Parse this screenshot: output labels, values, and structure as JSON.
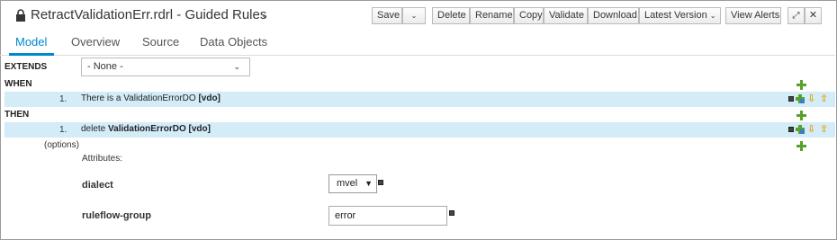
{
  "header": {
    "title": "RetractValidationErr.rdrl - Guided Rules",
    "buttons": {
      "save": "Save",
      "delete": "Delete",
      "rename": "Rename",
      "copy": "Copy",
      "validate": "Validate",
      "download": "Download",
      "latest_version": "Latest Version",
      "view_alerts": "View Alerts"
    }
  },
  "tabs": [
    "Model",
    "Overview",
    "Source",
    "Data Objects"
  ],
  "active_tab": "Model",
  "rule": {
    "extends_label": "EXTENDS",
    "extends_value": "- None -",
    "when_label": "WHEN",
    "when_rows": [
      {
        "num": "1.",
        "text": "There is a ValidationErrorDO",
        "binding": "[vdo]"
      }
    ],
    "then_label": "THEN",
    "then_rows": [
      {
        "num": "1.",
        "prefix": "delete",
        "text": "ValidationErrorDO [vdo]"
      }
    ],
    "options_label": "(options)",
    "attributes_label": "Attributes:",
    "attributes": [
      {
        "name": "dialect",
        "value": "mvel"
      },
      {
        "name": "ruleflow-group",
        "value": "error"
      }
    ]
  },
  "colors": {
    "accent": "#0088ce",
    "row_highlight": "#d4ecf8",
    "add_green": "#5aa02c"
  }
}
